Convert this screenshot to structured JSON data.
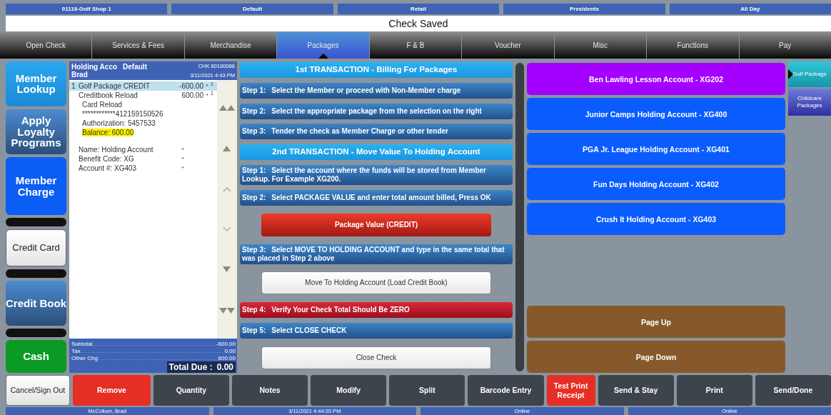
{
  "info_bar": [
    "01119-Golf Shop 1",
    "Default",
    "Retail",
    "Presidents",
    "All Day"
  ],
  "title": "Check Saved",
  "tabs": [
    {
      "label": "Open Check",
      "selected": false
    },
    {
      "label": "Services & Fees",
      "selected": false
    },
    {
      "label": "Merchandise",
      "selected": false
    },
    {
      "label": "Packages",
      "selected": true
    },
    {
      "label": "F & B",
      "selected": false
    },
    {
      "label": "Voucher",
      "selected": false
    },
    {
      "label": "Misc",
      "selected": false
    },
    {
      "label": "Functions",
      "selected": false
    },
    {
      "label": "Pay",
      "selected": false
    }
  ],
  "left_buttons": [
    {
      "kind": "cyan",
      "label": "Member Lookup"
    },
    {
      "kind": "slate",
      "label": "Apply Loyalty Programs"
    },
    {
      "kind": "blue",
      "label": "Member Charge"
    },
    {
      "kind": "blank"
    },
    {
      "kind": "plain",
      "label": "Credit Card"
    },
    {
      "kind": "blank"
    },
    {
      "kind": "slate",
      "label": "Credit Book"
    },
    {
      "kind": "blank"
    },
    {
      "kind": "green",
      "label": "Cash"
    }
  ],
  "check": {
    "account": "Holding Acco",
    "profile": "Default",
    "check_number": "CHK 60100066",
    "member": "Brad",
    "datetime": "3/11/2021 4:43 PM",
    "lines": [
      {
        "kind": "item",
        "qty": "1",
        "name": "Golf Package CREDIT",
        "amount": "-600.00",
        "flag": "*",
        "count": "1",
        "selected": true
      },
      {
        "kind": "item",
        "name": "Creditbook Reload",
        "amount": "600.00",
        "flag": "*",
        "count": "1",
        "selected": false
      },
      {
        "kind": "detail",
        "text": "Card Reload",
        "highlighted": false
      },
      {
        "kind": "detail",
        "text": "************412159150526",
        "highlighted": false
      },
      {
        "kind": "detail",
        "text": "Authorization: 5457533",
        "highlighted": false
      },
      {
        "kind": "detail",
        "text": "Balance: 600.00",
        "highlighted": true
      },
      {
        "kind": "info",
        "text": "Name: Holding Account",
        "flag": "*"
      },
      {
        "kind": "info",
        "text": "Benefit Code: XG",
        "flag": "*"
      },
      {
        "kind": "info",
        "text": "Account #: XG403",
        "flag": "*"
      }
    ],
    "totals": [
      {
        "label": "Subtotal",
        "value": "-600.00"
      },
      {
        "label": "Tax",
        "value": "0.00"
      },
      {
        "label": "Other Chg",
        "value": "600.00"
      }
    ],
    "total_due": {
      "label": "Total Due :",
      "value": "0.00"
    }
  },
  "instructions": [
    {
      "kind": "heading",
      "text": "1st TRANSACTION - Billing For Packages"
    },
    {
      "kind": "step",
      "step": "Step 1:",
      "text": "Select the Member or proceed with Non-Member charge"
    },
    {
      "kind": "step",
      "step": "Step 2:",
      "text": "Select the appropriate package from the selection on the right"
    },
    {
      "kind": "step",
      "step": "Step 3:",
      "text": "Tender the check as Member Charge or other tender"
    },
    {
      "kind": "heading",
      "text": "2nd TRANSACTION - Move Value To Holding Account"
    },
    {
      "kind": "step",
      "step": "Step 1:",
      "text": "Select the account where the funds will be stored from Member Lookup. For Example XG200."
    },
    {
      "kind": "step",
      "step": "Step 2:",
      "text": "Select PACKAGE VALUE and enter total amount billed, Press OK"
    },
    {
      "kind": "red-button",
      "text": "Package Value (CREDIT)"
    },
    {
      "kind": "step",
      "step": "Step 3:",
      "text": "Select MOVE TO HOLDING ACCOUNT and type in the same total that was placed in Step 2 above"
    },
    {
      "kind": "plain-button",
      "text": "Move To Holding Account (Load Credit Book)"
    },
    {
      "kind": "warning",
      "step": "Step 4:",
      "text": "Verify Your Check Total Should Be ZERO"
    },
    {
      "kind": "step",
      "step": "Step 5:",
      "text": "Select CLOSE CHECK"
    },
    {
      "kind": "plain-button",
      "text": "Close Check"
    }
  ],
  "accounts": [
    {
      "label": "Ben Lawling Lesson Account - XG202",
      "color": "#a300ff"
    },
    {
      "label": "Junior Camps Holding Account - XG400",
      "color": "#0a5cff"
    },
    {
      "label": "PGA Jr. League Holding Account - XG401",
      "color": "#0a5cff"
    },
    {
      "label": "Fun Days Holding Account - XG402",
      "color": "#0a5cff"
    },
    {
      "label": "Crush It Holding Account - XG403",
      "color": "#0a5cff"
    }
  ],
  "paging": [
    "Page Up",
    "Page Down"
  ],
  "categories": [
    {
      "label": "Golf Package",
      "selected": true
    },
    {
      "label": "Childcare Packages",
      "selected": false
    }
  ],
  "actions": [
    {
      "kind": "plain",
      "label": "Cancel/Sign Out"
    },
    {
      "kind": "red",
      "label": "Remove"
    },
    {
      "kind": "dark",
      "label": "Quantity"
    },
    {
      "kind": "dark",
      "label": "Notes"
    },
    {
      "kind": "dark",
      "label": "Modify"
    },
    {
      "kind": "dark",
      "label": "Split"
    },
    {
      "kind": "dark",
      "label": "Barcode Entry"
    },
    {
      "kind": "alert",
      "label": "Test Print Receipt"
    },
    {
      "kind": "dark",
      "label": "Send & Stay"
    },
    {
      "kind": "dark",
      "label": "Print"
    },
    {
      "kind": "dark",
      "label": "Send/Done"
    }
  ],
  "status_bar": [
    "McCollum, Brad",
    "3/11/2021 4:44:03 PM",
    "Online",
    "Online"
  ]
}
